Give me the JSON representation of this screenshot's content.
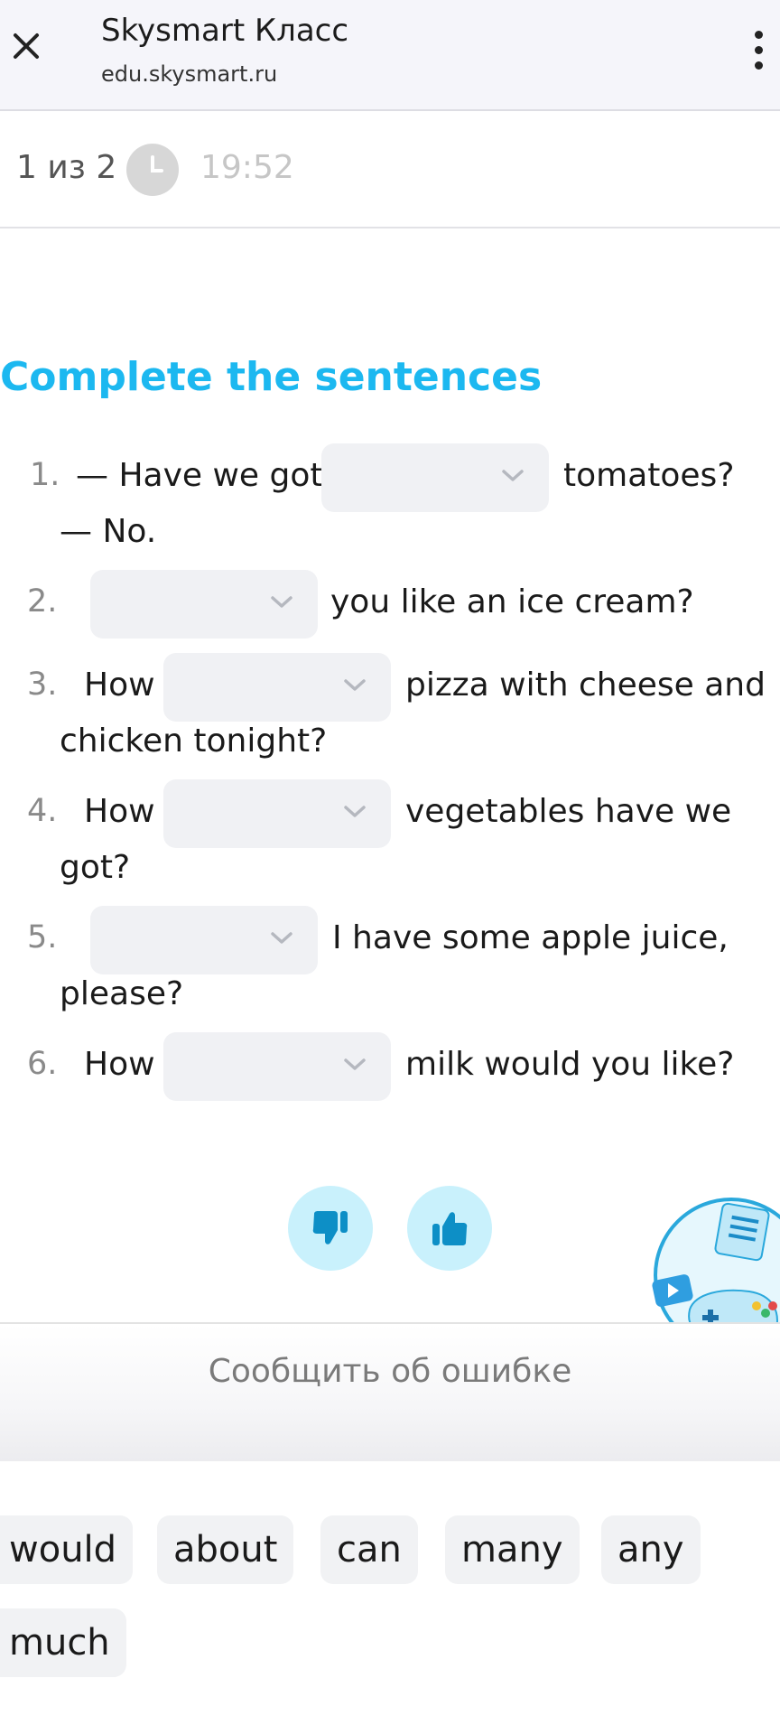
{
  "browser": {
    "title": "Skysmart Класс",
    "url": "edu.skysmart.ru",
    "close_icon": "close-icon",
    "menu_icon": "more-vertical-icon"
  },
  "progress": {
    "counter": "1 из 2",
    "timer": "19:52",
    "timer_icon": "clock-icon"
  },
  "task": {
    "title": "Complete the sentences",
    "questions": [
      {
        "num": "1.",
        "before": "— Have we got",
        "after": "tomatoes?",
        "line2": "— No.",
        "selected": ""
      },
      {
        "num": "2.",
        "before": "",
        "after": "you like an ice cream?",
        "line2": "",
        "selected": ""
      },
      {
        "num": "3.",
        "before": "How",
        "after": "pizza with cheese and",
        "line2": "chicken tonight?",
        "selected": ""
      },
      {
        "num": "4.",
        "before": "How",
        "after": "vegetables have we",
        "line2": "got?",
        "selected": ""
      },
      {
        "num": "5.",
        "before": "",
        "after": "I have some apple juice,",
        "line2": "please?",
        "selected": ""
      },
      {
        "num": "6.",
        "before": "How",
        "after": "milk would you like?",
        "line2": "",
        "selected": ""
      }
    ]
  },
  "rating": {
    "dislike_icon": "thumbs-down-icon",
    "like_icon": "thumbs-up-icon"
  },
  "report": {
    "label": "Сообщить об ошибке"
  },
  "word_bank": {
    "words": [
      "would",
      "about",
      "can",
      "many",
      "any",
      "much"
    ]
  },
  "colors": {
    "accent": "#1cb8f0",
    "rating_bg": "#c9f1fc",
    "select_bg": "#f0f1f4",
    "chip_bg": "#f1f2f4"
  }
}
